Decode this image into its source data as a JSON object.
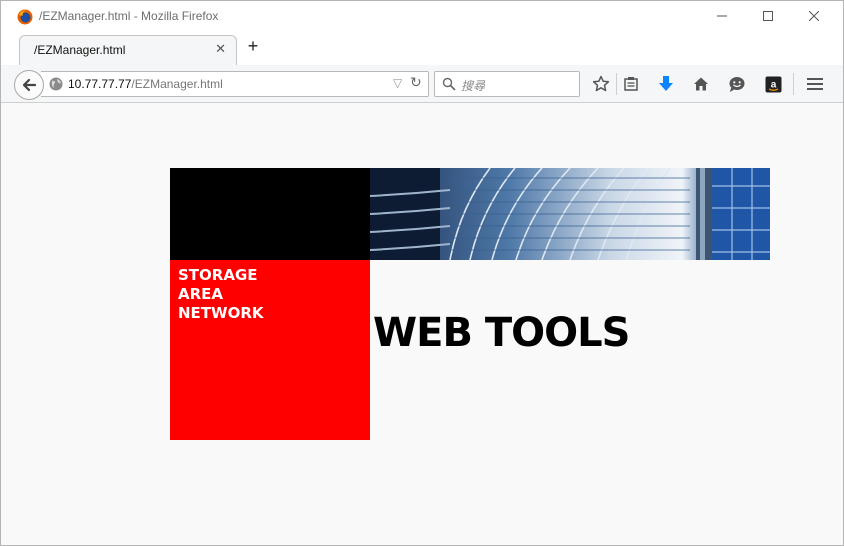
{
  "window": {
    "title": "/EZManager.html - Mozilla Firefox",
    "minimize_icon": "minimize-icon",
    "maximize_icon": "maximize-icon",
    "close_icon": "close-icon"
  },
  "tabs": [
    {
      "label": "/EZManager.html",
      "active": true
    }
  ],
  "new_tab_label": "+",
  "navbar": {
    "url_host": "10.77.77.77",
    "url_path": "/EZManager.html",
    "search_placeholder": "搜尋",
    "icons": [
      "back-arrow-icon",
      "globe-icon",
      "dropdown-icon",
      "reload-icon",
      "search-icon",
      "bookmark-star-icon",
      "reading-list-icon",
      "download-icon",
      "home-icon",
      "chat-icon",
      "amazon-icon",
      "menu-icon"
    ]
  },
  "page": {
    "san_lines": [
      "STORAGE",
      "AREA",
      "NETWORK"
    ],
    "heading": "WEB TOOLS"
  },
  "colors": {
    "accent_red": "#ff0000",
    "download_blue": "#0a84ff"
  }
}
